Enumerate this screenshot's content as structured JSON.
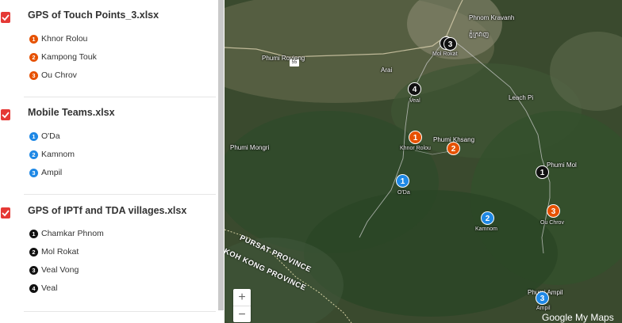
{
  "sidebar": {
    "layers": [
      {
        "title": "GPS of Touch Points_3.xlsx",
        "items": [
          {
            "num": "1",
            "label": "Khnor Rolou",
            "color": "#e65100"
          },
          {
            "num": "2",
            "label": "Kampong Touk",
            "color": "#e65100"
          },
          {
            "num": "3",
            "label": "Ou Chrov",
            "color": "#e65100"
          }
        ]
      },
      {
        "title": "Mobile Teams.xlsx",
        "items": [
          {
            "num": "1",
            "label": "O'Da",
            "color": "#1e88e5"
          },
          {
            "num": "2",
            "label": "Kamnom",
            "color": "#1e88e5"
          },
          {
            "num": "3",
            "label": "Ampil",
            "color": "#1e88e5"
          }
        ]
      },
      {
        "title": "GPS of IPTf and TDA villages.xlsx",
        "items": [
          {
            "num": "1",
            "label": "Chamkar Phnom",
            "color": "#111111"
          },
          {
            "num": "2",
            "label": "Mol Rokat",
            "color": "#111111"
          },
          {
            "num": "3",
            "label": "Veal Vong",
            "color": "#111111"
          },
          {
            "num": "4",
            "label": "Veal",
            "color": "#111111"
          }
        ]
      }
    ]
  },
  "map": {
    "places": {
      "phnom_kravanh": "Phnom Kravanh",
      "phnom_kravanh_km": "ភ្នំក្រវាញ",
      "phumi_rovieng": "Phumi Rovieng",
      "arai": "Arai",
      "leach_pi": "Leach Pi",
      "phumi_mongri": "Phumi Mongri",
      "phumi_khsang": "Phumi Khsang",
      "phumi_mol": "Phumi Mol",
      "phumi_ampil": "Phumi Ampil"
    },
    "road_shield": "55",
    "provinces": {
      "pursat": "PURSAT PROVINCE",
      "koh_kong": "KOH KONG PROVINCE"
    },
    "pin_labels": {
      "mol_rokat": "Mol Rokat",
      "veal": "Veal",
      "khnor_rolou": "Khnor Rolou",
      "o_da": "O'Da",
      "kamnom": "Kamnom",
      "ou_chrov": "Ou Chrov",
      "ampil": "Ampil"
    },
    "pins": {
      "black_1": "1",
      "black_3": "3",
      "black_4": "4",
      "orange_1": "1",
      "orange_2": "2",
      "orange_3": "3",
      "blue_1": "1",
      "blue_2": "2",
      "blue_3": "3"
    },
    "zoom_in": "+",
    "zoom_out": "−",
    "brand": "Google My Maps"
  }
}
